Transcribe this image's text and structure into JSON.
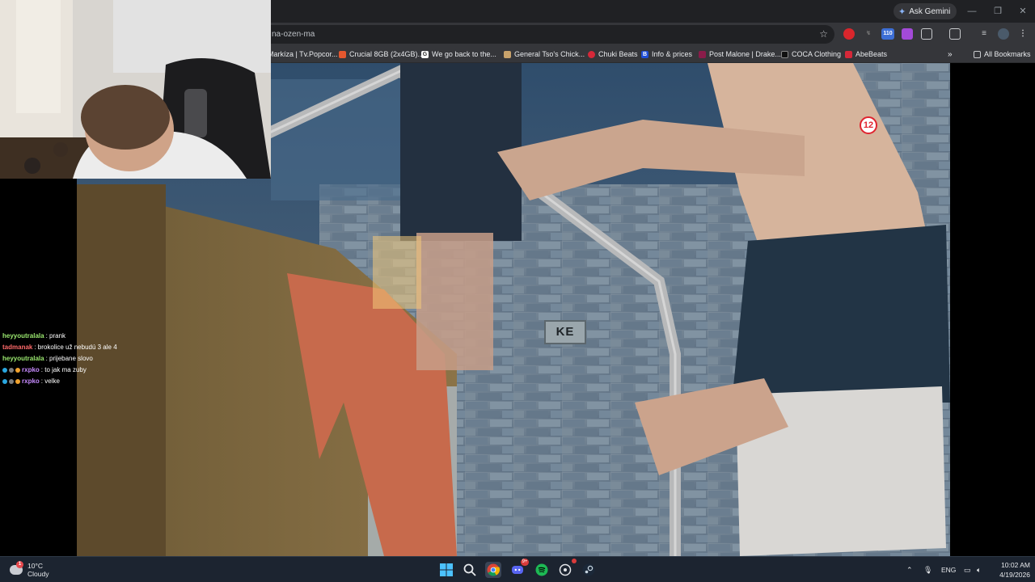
{
  "browser": {
    "ask_gemini": "Ask Gemini",
    "address_text": "na-ozen-ma",
    "extension_badge": "110",
    "bookmarks": [
      {
        "label": "Markíza | Tv.Popcor...",
        "color": "#2b2b2b"
      },
      {
        "label": "Crucial 8GB (2x4GB)...",
        "color": "#e4572e"
      },
      {
        "label": "We go back to the...",
        "color": "#ffffff"
      },
      {
        "label": "General Tso's Chick...",
        "color": "#c8a26b"
      },
      {
        "label": "Chuki Beats",
        "color": "#d62839"
      },
      {
        "label": "Info & prices",
        "color": "#1f4ed8"
      },
      {
        "label": "Post Malone | Drake...",
        "color": "#8a1c4a"
      },
      {
        "label": "COCA Clothing",
        "color": "#111111"
      },
      {
        "label": "AbeBeats",
        "color": "#d62839"
      }
    ],
    "all_bookmarks": "All Bookmarks"
  },
  "video": {
    "rating_badge": "12",
    "sign_text": "KE"
  },
  "chat": [
    {
      "user": "heyyoutralala",
      "user_color": "#9be86f",
      "message": ": prank",
      "badges": false
    },
    {
      "user": "tadmanak",
      "user_color": "#ff6a6a",
      "message": ": brokolice už nebudú 3 ale 4",
      "badges": false
    },
    {
      "user": "heyyoutralala",
      "user_color": "#9be86f",
      "message": ": prijebane slovo",
      "badges": false
    },
    {
      "user": "rxpko",
      "user_color": "#c78bff",
      "message": ": to jak ma zuby",
      "badges": true
    },
    {
      "user": "rxpko",
      "user_color": "#c78bff",
      "message": ": velke",
      "badges": true
    }
  ],
  "taskbar": {
    "weather_temp": "10°C",
    "weather_desc": "Cloudy",
    "weather_alert": "1",
    "discord_badge": "9+",
    "language": "ENG",
    "time": "10:02 AM",
    "date": "4/19/2026"
  }
}
